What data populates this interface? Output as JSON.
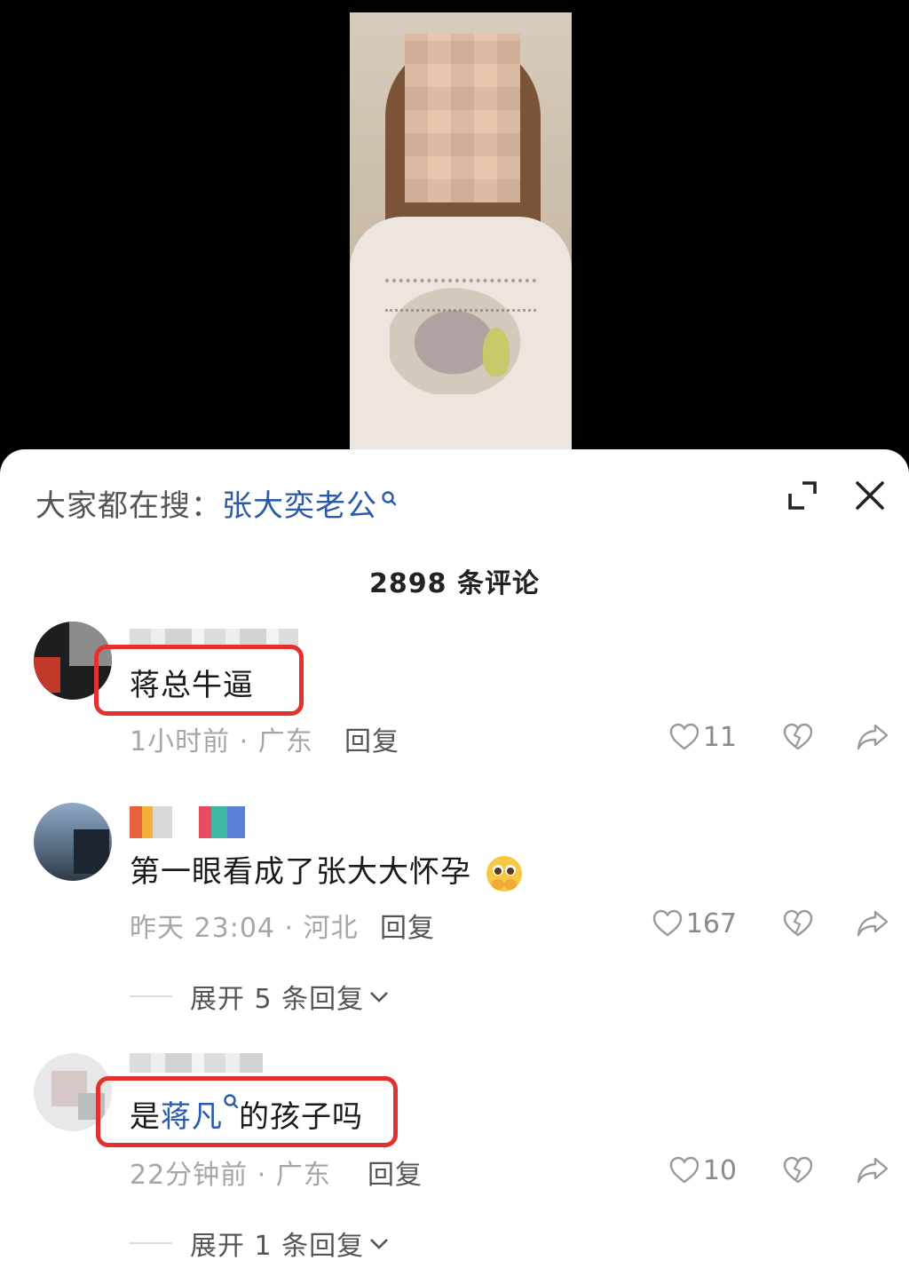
{
  "search": {
    "label": "大家都在搜：",
    "term": "张大奕老公"
  },
  "comments_header": {
    "count_text": "2898 条评论"
  },
  "comments": [
    {
      "text": "蒋总牛逼",
      "time_location": "1小时前 · 广东",
      "reply": "回复",
      "likes": "11"
    },
    {
      "text": "第一眼看成了张大大怀孕",
      "time_location": "昨天 23:04 · 河北",
      "reply": "回复",
      "likes": "167",
      "expand": "展开 5 条回复"
    },
    {
      "text_prefix": "是",
      "text_link": "蒋凡",
      "text_suffix": "的孩子吗",
      "time_location": "22分钟前 · 广东",
      "reply": "回复",
      "likes": "10",
      "expand": "展开 1 条回复"
    }
  ],
  "icons": {
    "expand": "expand-icon",
    "close": "close-icon",
    "like": "heart-outline-icon",
    "dislike": "broken-heart-icon",
    "share": "share-arrow-icon",
    "search_link": "search-icon",
    "emoji": "pleading-face-emoji-icon"
  },
  "colors": {
    "link": "#2b5aa8",
    "highlight": "#e5312d",
    "meta": "#a6a6a6"
  }
}
